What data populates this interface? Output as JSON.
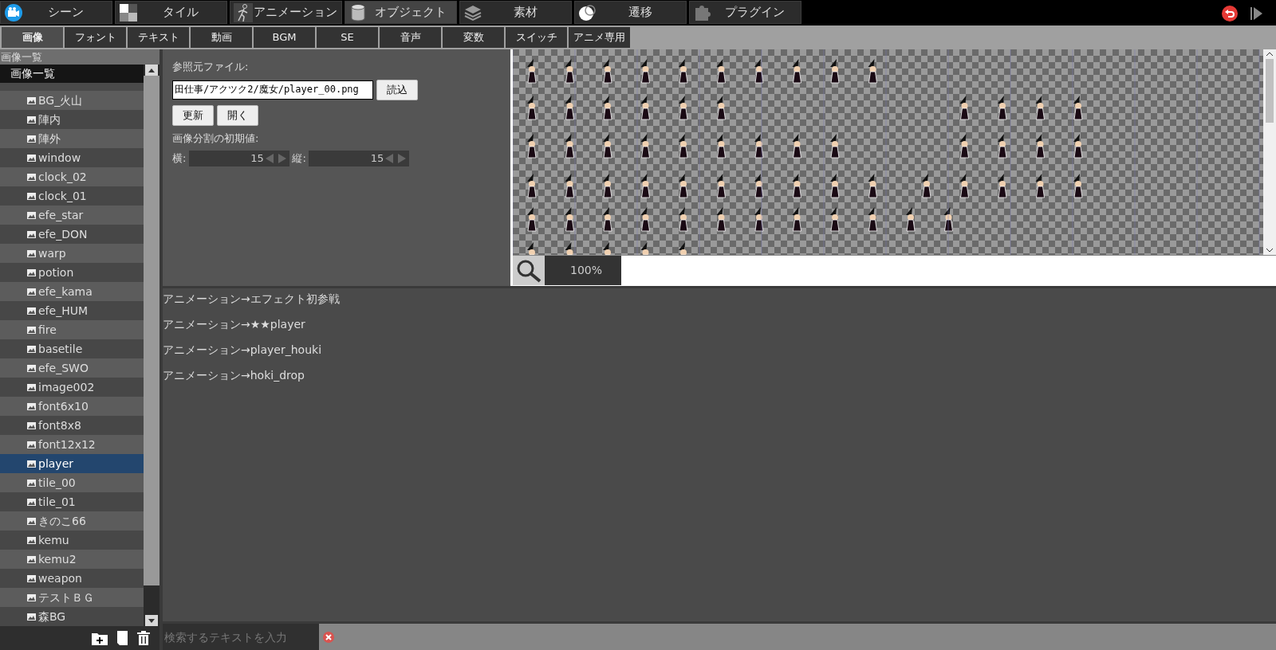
{
  "top_tabs": [
    {
      "label": "シーン",
      "kind": "scene",
      "selected": false
    },
    {
      "label": "タイル",
      "kind": "tile",
      "selected": false
    },
    {
      "label": "アニメーション",
      "kind": "animation",
      "selected": false
    },
    {
      "label": "オブジェクト",
      "kind": "object",
      "selected": true
    },
    {
      "label": "素材",
      "kind": "material",
      "selected": false
    },
    {
      "label": "遷移",
      "kind": "transition",
      "selected": false
    },
    {
      "label": "プラグイン",
      "kind": "plugin",
      "selected": false
    }
  ],
  "sub_tabs": [
    {
      "label": "画像",
      "selected": true
    },
    {
      "label": "フォント",
      "selected": false
    },
    {
      "label": "テキスト",
      "selected": false
    },
    {
      "label": "動画",
      "selected": false
    },
    {
      "label": "BGM",
      "selected": false
    },
    {
      "label": "SE",
      "selected": false
    },
    {
      "label": "音声",
      "selected": false
    },
    {
      "label": "変数",
      "selected": false
    },
    {
      "label": "スイッチ",
      "selected": false
    },
    {
      "label": "アニメ専用",
      "selected": false
    }
  ],
  "sidebar": {
    "title": "画像一覧",
    "tree_root": "画像一覧",
    "items": [
      {
        "label": "BG_火山",
        "selected": false
      },
      {
        "label": "陣内",
        "selected": false
      },
      {
        "label": "陣外",
        "selected": false
      },
      {
        "label": "window",
        "selected": false
      },
      {
        "label": "clock_02",
        "selected": false
      },
      {
        "label": "clock_01",
        "selected": false
      },
      {
        "label": "efe_star",
        "selected": false
      },
      {
        "label": "efe_DON",
        "selected": false
      },
      {
        "label": "warp",
        "selected": false
      },
      {
        "label": "potion",
        "selected": false
      },
      {
        "label": "efe_kama",
        "selected": false
      },
      {
        "label": "efe_HUM",
        "selected": false
      },
      {
        "label": "fire",
        "selected": false
      },
      {
        "label": "basetile",
        "selected": false
      },
      {
        "label": "efe_SWO",
        "selected": false
      },
      {
        "label": "image002",
        "selected": false
      },
      {
        "label": "font6x10",
        "selected": false
      },
      {
        "label": "font8x8",
        "selected": false
      },
      {
        "label": "font12x12",
        "selected": false
      },
      {
        "label": "player",
        "selected": true
      },
      {
        "label": "tile_00",
        "selected": false
      },
      {
        "label": "tile_01",
        "selected": false
      },
      {
        "label": "きのこ66",
        "selected": false
      },
      {
        "label": "kemu",
        "selected": false
      },
      {
        "label": "kemu2",
        "selected": false
      },
      {
        "label": "weapon",
        "selected": false
      },
      {
        "label": "テストＢＧ",
        "selected": false
      },
      {
        "label": "森BG",
        "selected": false
      }
    ]
  },
  "source_panel": {
    "file_label": "参照元ファイル:",
    "file_value": "田仕事/アクツク2/魔女/player_00.png",
    "load_button": "読込",
    "buttons": [
      "更新",
      "開く"
    ],
    "split_label": "画像分割の初期値:",
    "split_fields": [
      {
        "label": "横:",
        "value": "15"
      },
      {
        "label": "縦:",
        "value": "15"
      }
    ]
  },
  "viewer": {
    "zoom": "100%"
  },
  "log": [
    "アニメーション→エフェクト初参戦",
    "アニメーション→★★player",
    "アニメーション→player_houki",
    "アニメーション→hoki_drop"
  ],
  "search": {
    "placeholder": "検索するテキストを入力"
  }
}
